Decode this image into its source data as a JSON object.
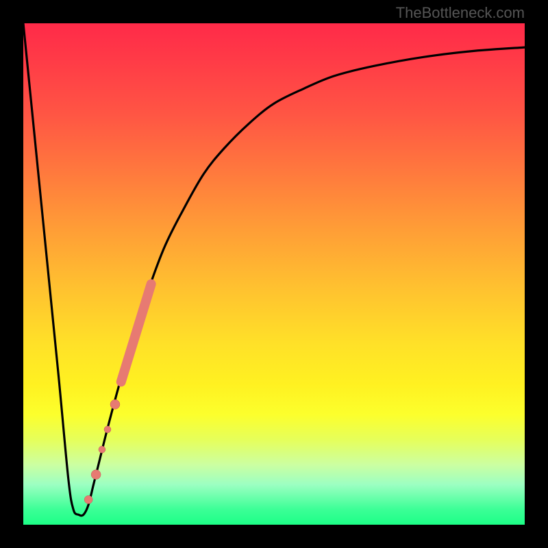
{
  "watermark": "TheBottleneck.com",
  "colors": {
    "frame": "#000000",
    "curve": "#000000",
    "marker_fill": "#e77a72",
    "marker_stroke": "#c45a52",
    "gradient_top": "#ff2a48",
    "gradient_bottom": "#1dff87"
  },
  "chart_data": {
    "type": "line",
    "title": "",
    "xlabel": "",
    "ylabel": "",
    "x_range": [
      0,
      100
    ],
    "y_range": [
      0,
      100
    ],
    "series": [
      {
        "name": "bottleneck-curve",
        "x": [
          0,
          4,
          7,
          9,
          10,
          11,
          12,
          13,
          14,
          15,
          17,
          20,
          24,
          28,
          32,
          36,
          40,
          45,
          50,
          56,
          62,
          70,
          80,
          90,
          100
        ],
        "y": [
          100,
          60,
          30,
          9,
          3,
          2,
          2,
          4,
          8,
          12,
          20,
          31,
          44,
          55,
          63,
          70,
          75,
          80,
          84,
          87,
          89.5,
          91.5,
          93.3,
          94.5,
          95.2
        ]
      }
    ],
    "markers": [
      {
        "x": 13.0,
        "y": 5.0,
        "r": 6
      },
      {
        "x": 14.5,
        "y": 10.0,
        "r": 7
      },
      {
        "x": 15.7,
        "y": 15.0,
        "r": 5
      },
      {
        "x": 16.8,
        "y": 19.0,
        "r": 5
      },
      {
        "x": 18.3,
        "y": 24.0,
        "r": 7
      }
    ],
    "marker_band": {
      "x_start": 19.5,
      "y_start": 28.5,
      "x_end": 25.5,
      "y_end": 48.0,
      "width": 14
    }
  }
}
